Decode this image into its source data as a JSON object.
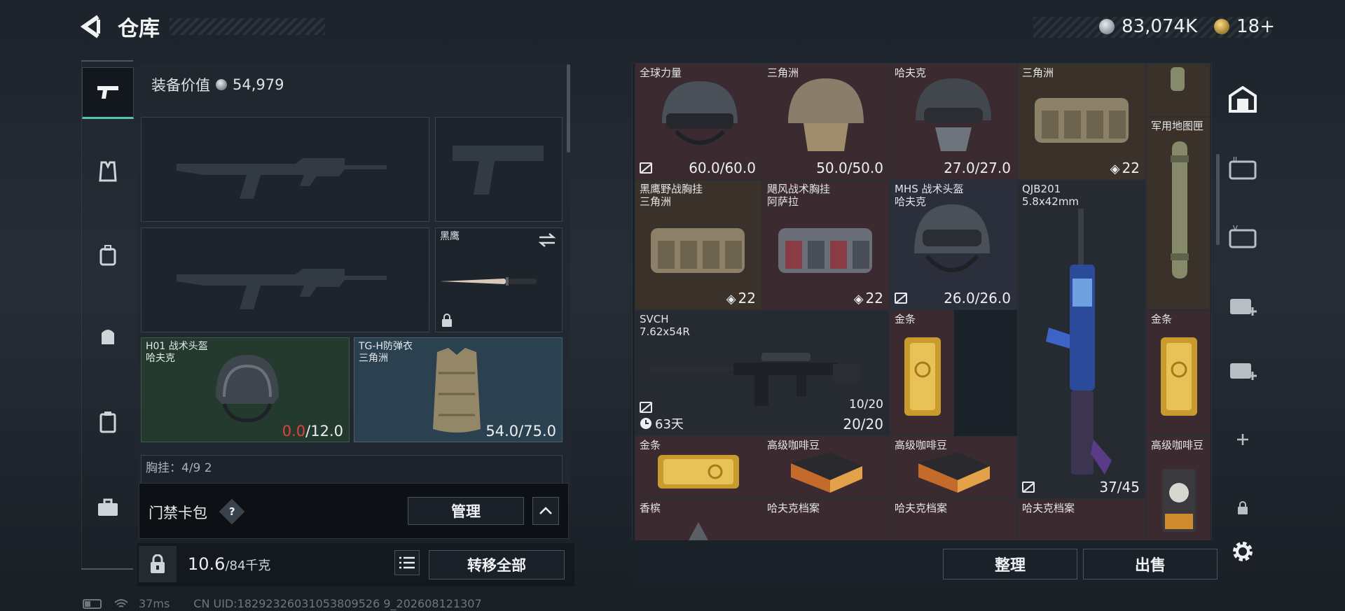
{
  "header": {
    "title": "仓库",
    "currency_amount": "83,074K",
    "tickets": "18+"
  },
  "left_panel": {
    "equip_value_label": "装备价值",
    "equip_value": "54,979",
    "melee_label": "黑鹰",
    "helmet": {
      "name": "H01 战术头盔",
      "brand": "哈夫克",
      "durability_current": "0.0",
      "durability_max": "/12.0"
    },
    "armor": {
      "name": "TG-H防弹衣",
      "brand": "三角洲",
      "durability": "54.0/75.0"
    },
    "chest_rig_peek": "胸挂：4/9  2",
    "access_card_label": "门禁卡包",
    "help": "?",
    "manage_button": "管理",
    "weight": "10.6",
    "weight_max": "/84千克",
    "transfer_all": "转移全部"
  },
  "grid": {
    "cells": [
      {
        "id": "r1c1",
        "name": "全球力量",
        "value": "60.0/60.0"
      },
      {
        "id": "r1c2",
        "name": "三角洲",
        "value": "50.0/50.0"
      },
      {
        "id": "r1c3",
        "name": "哈夫克",
        "value": "27.0/27.0"
      },
      {
        "id": "r1c4",
        "name": "三角洲",
        "value": "22"
      },
      {
        "id": "military-map",
        "name": "军用地图匣",
        "value": ""
      },
      {
        "id": "r2c1",
        "name": "黑鹰野战胸挂\n三角洲",
        "value": "22"
      },
      {
        "id": "r2c2",
        "name": "飓风战术胸挂\n阿萨拉",
        "value": "22"
      },
      {
        "id": "r2c3",
        "name": "MHS 战术头盔\n哈夫克",
        "value": "26.0/26.0"
      },
      {
        "id": "qjb",
        "name": "QJB201\n5.8x42mm",
        "value": "37/45"
      },
      {
        "id": "svch",
        "name": "SVCH\n7.62x54R",
        "value": "20/20",
        "value2": "10/20",
        "timer": "63天"
      },
      {
        "id": "gold1",
        "name": "金条",
        "value": ""
      },
      {
        "id": "gold2",
        "name": "金条",
        "value": ""
      },
      {
        "id": "gold3",
        "name": "金条",
        "value": ""
      },
      {
        "id": "coffee1",
        "name": "高级咖啡豆",
        "value": ""
      },
      {
        "id": "coffee2",
        "name": "高级咖啡豆",
        "value": ""
      },
      {
        "id": "coffee3",
        "name": "高级咖啡豆",
        "value": ""
      },
      {
        "id": "r5c1",
        "name": "香槟",
        "value": ""
      },
      {
        "id": "r5c2",
        "name": "哈夫克档案",
        "value": ""
      },
      {
        "id": "r5c3",
        "name": "哈夫克档案",
        "value": ""
      },
      {
        "id": "r5c4",
        "name": "哈夫克档案",
        "value": ""
      }
    ],
    "sort_button": "整理",
    "sell_button": "出售"
  },
  "status_bar": {
    "ping": "37ms",
    "uid": "CN UID:18292326031053809526 9_202608121307"
  },
  "colors": {
    "accent": "#4fc7b0",
    "durability_red": "#e0413f"
  }
}
